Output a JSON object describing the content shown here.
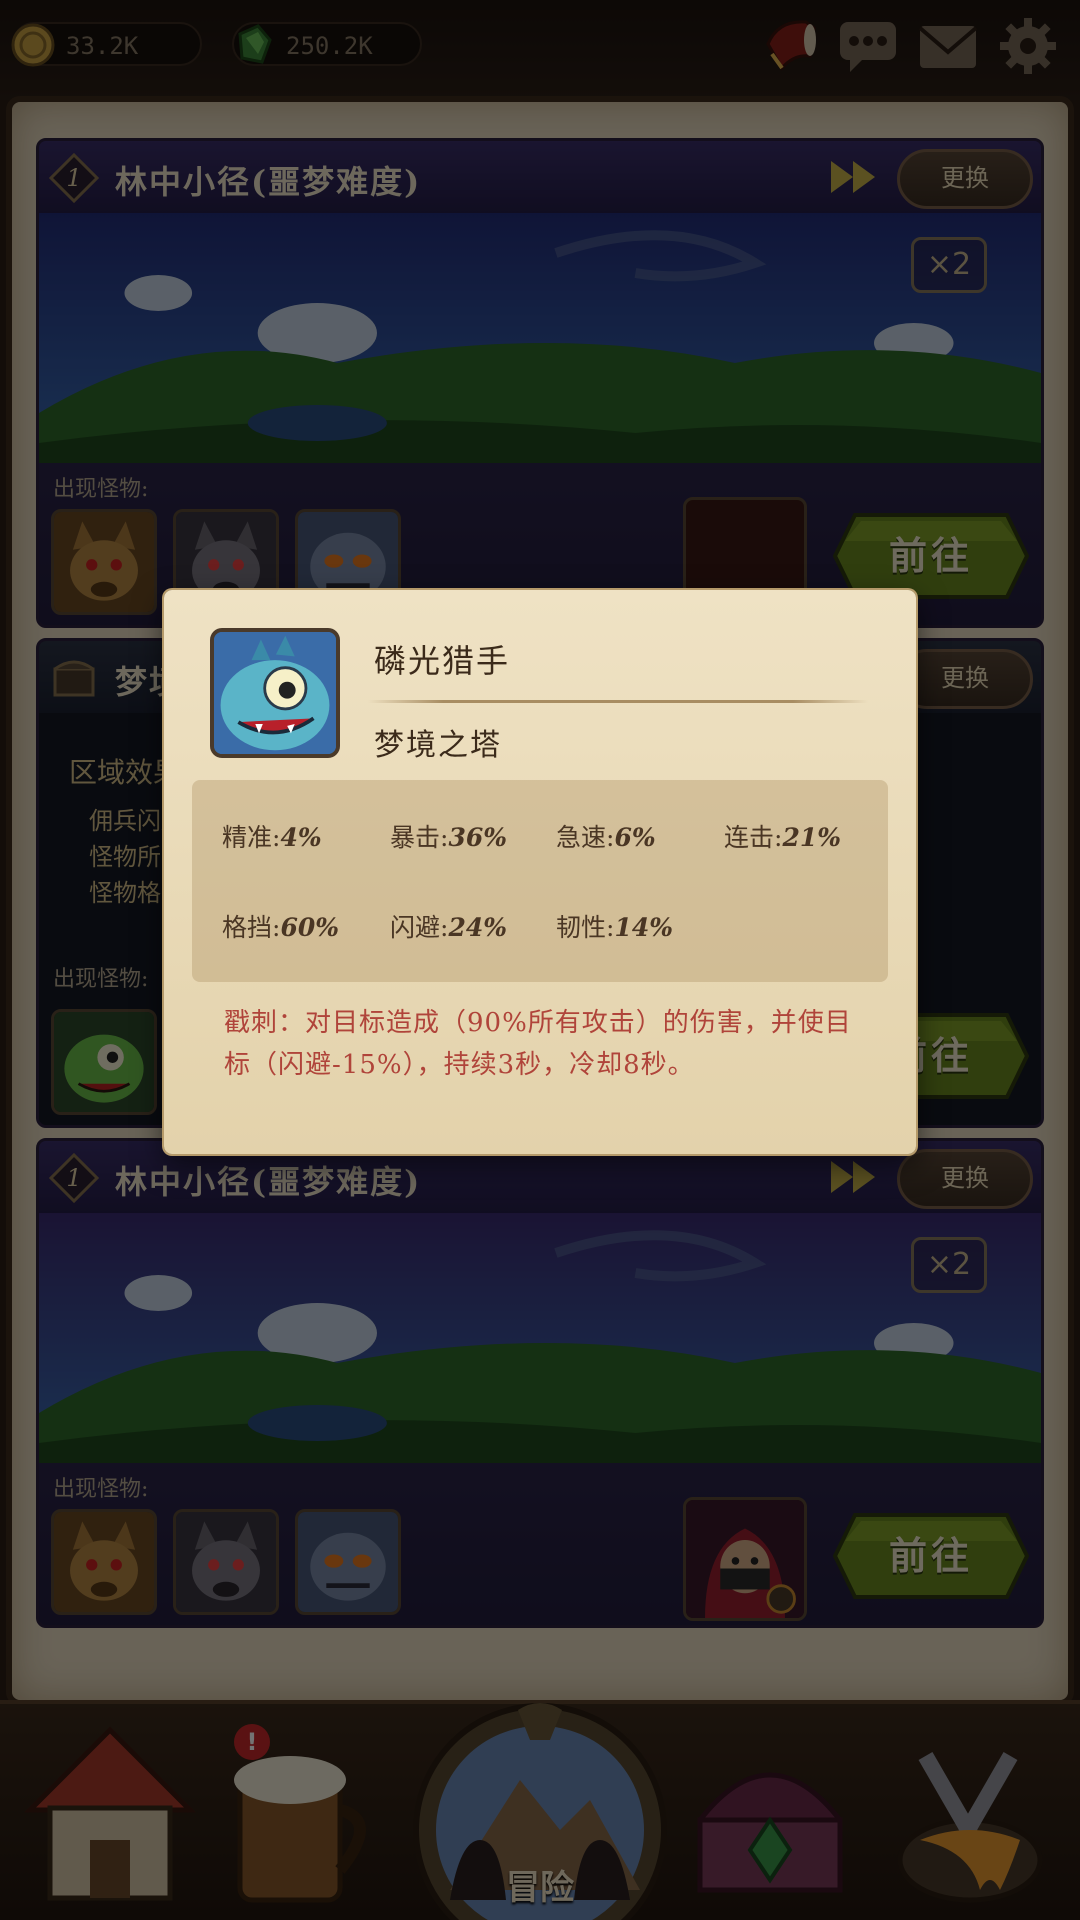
{
  "resources": {
    "gold": "33.2K",
    "gems": "250.2K"
  },
  "top_buttons": [
    "horn-icon",
    "chat-icon",
    "mail-icon",
    "settings-icon"
  ],
  "cards": [
    {
      "level": "1",
      "title": "林中小径(噩梦难度)",
      "swap_label": "更换",
      "multiplier": "×2",
      "monster_label": "出现怪物:",
      "go_label": "前往"
    },
    {
      "title": "梦境之塔",
      "swap_label": "更换",
      "monster_label": "出现怪物:",
      "go_label": "前往",
      "zone_label": "区域效果:",
      "effects": [
        "佣兵闪避",
        "怪物所",
        "怪物格"
      ]
    },
    {
      "level": "1",
      "title": "林中小径(噩梦难度)",
      "swap_label": "更换",
      "multiplier": "×2",
      "monster_label": "出现怪物:",
      "go_label": "前往"
    }
  ],
  "popup": {
    "name": "磷光猎手",
    "origin": "梦境之塔",
    "stats": [
      {
        "label": "精准:",
        "value": "4%"
      },
      {
        "label": "暴击:",
        "value": "36%"
      },
      {
        "label": "急速:",
        "value": "6%"
      },
      {
        "label": "连击:",
        "value": "21%"
      },
      {
        "label": "格挡:",
        "value": "60%"
      },
      {
        "label": "闪避:",
        "value": "24%"
      },
      {
        "label": "韧性:",
        "value": "14%"
      }
    ],
    "skill": "戳刺：对目标造成（90%所有攻击）的伤害，并使目标（闪避-15%），持续3秒，冷却8秒。"
  },
  "bottom_nav": {
    "adventure_label": "冒险"
  },
  "colors": {
    "frame": "#3d2a1c",
    "card_header": "#2f2760",
    "go_button": "#6b8a1f",
    "skill_text": "#b0443a"
  }
}
